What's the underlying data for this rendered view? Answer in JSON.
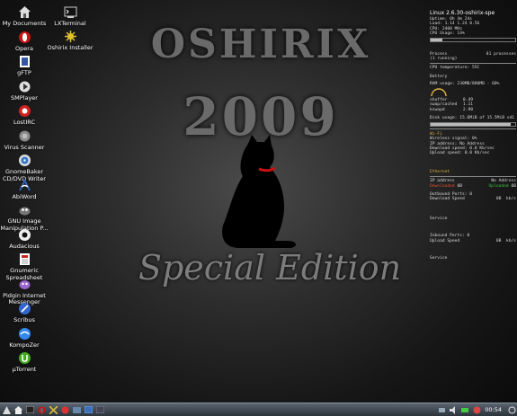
{
  "wallpaper": {
    "title_line1": "OSHIRIX",
    "title_line2": "2009",
    "subtitle": "Special Edition"
  },
  "desktop_icons_col1": [
    {
      "label": "My Documents",
      "icon": "home-icon",
      "color": "#dddddd"
    },
    {
      "label": "Opera",
      "icon": "opera-icon",
      "color": "#cc1111"
    },
    {
      "label": "gFTP",
      "icon": "gftp-icon",
      "color": "#3355aa"
    },
    {
      "label": "SMPlayer",
      "icon": "smplayer-icon",
      "color": "#dddddd"
    },
    {
      "label": "LostIRC",
      "icon": "lostirc-icon",
      "color": "#cc2222"
    },
    {
      "label": "Virus Scanner",
      "icon": "virus-scanner-icon",
      "color": "#888888"
    },
    {
      "label": "GnomeBaker CD/DVD Writer",
      "icon": "gnomebaker-icon",
      "color": "#3377cc"
    },
    {
      "label": "AbiWord",
      "icon": "abiword-icon",
      "color": "#3366bb"
    },
    {
      "label": "GNU Image Manipulation P...",
      "icon": "gimp-icon",
      "color": "#777777"
    },
    {
      "label": "Audacious",
      "icon": "audacious-icon",
      "color": "#eeeeee"
    },
    {
      "label": "Gnumeric Spreadsheet",
      "icon": "gnumeric-icon",
      "color": "#cc2222"
    },
    {
      "label": "Pidgin Internet Messenger",
      "icon": "pidgin-icon",
      "color": "#9966cc"
    },
    {
      "label": "Scribus",
      "icon": "scribus-icon",
      "color": "#3366cc"
    },
    {
      "label": "KompoZer",
      "icon": "kompozer-icon",
      "color": "#3388ee"
    },
    {
      "label": "µTorrent",
      "icon": "utorrent-icon",
      "color": "#44aa22"
    }
  ],
  "desktop_icons_col2": [
    {
      "label": "LXTerminal",
      "icon": "terminal-icon",
      "color": "#cccccc"
    },
    {
      "label": "Oshirix Installer",
      "icon": "installer-icon",
      "color": "#e0c030"
    }
  ],
  "conky": {
    "title": "Linux 2.6.30-oshirix-spe",
    "uptime": "Uptime: 0h 4m 24s",
    "load": "Load: 1.14 1.24 0.56",
    "cpu": "CPU: 2400 MHz",
    "cpu_usage": "CPU Usage: 14%",
    "process": "Process",
    "processes": "81 processes",
    "running": "(1 running)",
    "cpu_temp": "CPU temperature: 55C",
    "battery": "Battery",
    "ram_usage": "RAM usage: 230MB/880MB - 60%",
    "buffer_label": "shuffer",
    "buffer_value": "0.49",
    "swap_label": "swap/cached",
    "swap_value": "1.11",
    "kswapd_label": "kswapd",
    "kswapd_value": "2.98",
    "disk_usage": "Disk usage: 15.6MiB of 15.5MiB sd1",
    "wifi": "Wi-Fi",
    "wireless_signal": "Wireless signal: 0%",
    "ip_address": "IP address: No Address",
    "download_speed": "Download speed: 0.0 Kb/sec",
    "upload_speed": "Upload speed: 0.0 Kb/sec",
    "ethernet": "Ethernet",
    "eth_ip_label": "IP address",
    "eth_ip_value": "No Address",
    "downloaded_label": "Downloaded",
    "downloaded_value": "0B",
    "uploaded_label": "Uploaded",
    "uploaded_value": "0B",
    "outbound_ports": "Outbound Ports: 0",
    "download_speed2_label": "Download Speed",
    "download_speed2_value": "0B",
    "unit1": "kb/s",
    "service1": "Service",
    "inbound_ports": "Inbound Ports: 0",
    "upload_speed2_label": "Upload Speed",
    "upload_speed2_value": "0B",
    "unit2": "kb/s",
    "service2": "Service",
    "cpu_bar_fraction": 0.14,
    "ram_bar_fraction": 0.6,
    "disk_bar_fraction": 0.95
  },
  "taskbar": {
    "clock": "00:54",
    "accent": "#4a5560"
  }
}
